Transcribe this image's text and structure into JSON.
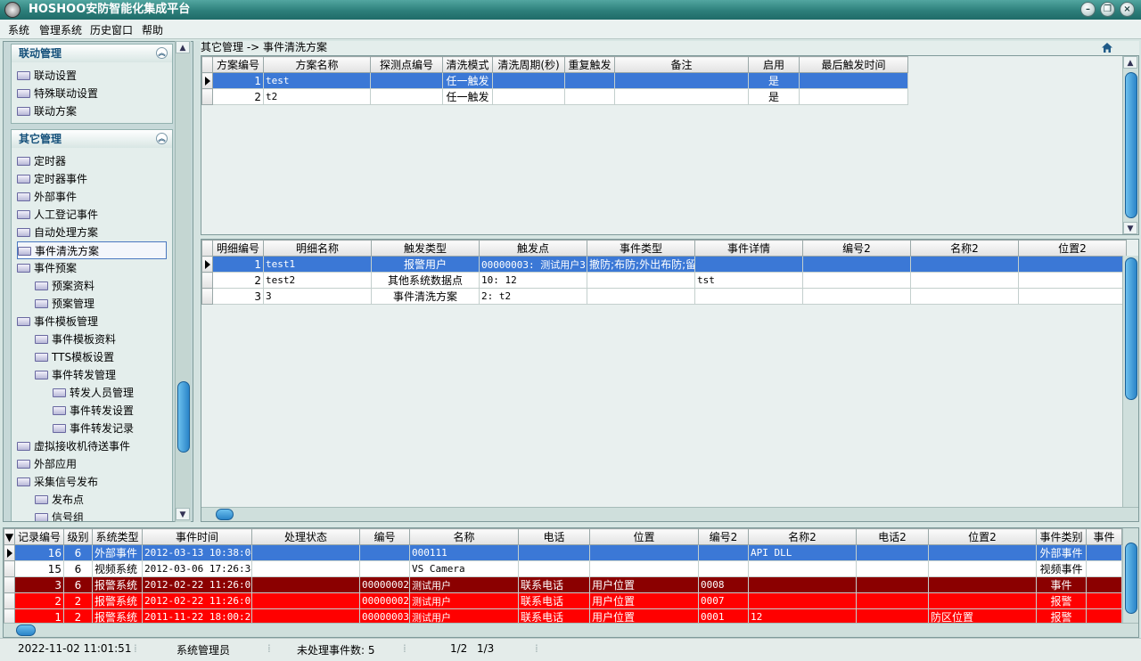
{
  "app": {
    "title": "HOSHOO安防智能化集成平台"
  },
  "menu": [
    "系统",
    "管理系统",
    "历史窗口",
    "帮助"
  ],
  "sidebar": {
    "group1": {
      "title": "联动管理",
      "items": [
        "联动设置",
        "特殊联动设置",
        "联动方案"
      ]
    },
    "group2": {
      "title": "其它管理",
      "items": [
        {
          "label": "定时器",
          "level": 0
        },
        {
          "label": "定时器事件",
          "level": 0
        },
        {
          "label": "外部事件",
          "level": 0
        },
        {
          "label": "人工登记事件",
          "level": 0
        },
        {
          "label": "自动处理方案",
          "level": 0
        },
        {
          "label": "事件清洗方案",
          "level": 0,
          "selected": true
        },
        {
          "label": "事件预案",
          "level": 0
        },
        {
          "label": "预案资料",
          "level": 1
        },
        {
          "label": "预案管理",
          "level": 1
        },
        {
          "label": "事件模板管理",
          "level": 0
        },
        {
          "label": "事件模板资料",
          "level": 1
        },
        {
          "label": "TTS模板设置",
          "level": 1
        },
        {
          "label": "事件转发管理",
          "level": 1
        },
        {
          "label": "转发人员管理",
          "level": 2
        },
        {
          "label": "事件转发设置",
          "level": 2
        },
        {
          "label": "事件转发记录",
          "level": 2
        },
        {
          "label": "虚拟接收机待送事件",
          "level": 0
        },
        {
          "label": "外部应用",
          "level": 0
        },
        {
          "label": "采集信号发布",
          "level": 0
        },
        {
          "label": "发布点",
          "level": 1
        },
        {
          "label": "信号组",
          "level": 1
        }
      ]
    }
  },
  "breadcrumb": "其它管理 -> 事件清洗方案",
  "plan_table": {
    "columns": [
      "方案编号",
      "方案名称",
      "探测点编号",
      "清洗模式",
      "清洗周期(秒)",
      "重复触发",
      "备注",
      "启用",
      "最后触发时间"
    ],
    "rows": [
      [
        "1",
        "test",
        "",
        "任一触发",
        "",
        "",
        "",
        "是",
        ""
      ],
      [
        "2",
        "t2",
        "",
        "任一触发",
        "",
        "",
        "",
        "是",
        ""
      ]
    ]
  },
  "detail_table": {
    "columns": [
      "明细编号",
      "明细名称",
      "触发类型",
      "触发点",
      "事件类型",
      "事件详情",
      "编号2",
      "名称2",
      "位置2"
    ],
    "rows": [
      [
        "1",
        "test1",
        "报警用户",
        "00000003: 测试用户3",
        "撤防;布防;外出布防;留",
        "",
        "",
        "",
        ""
      ],
      [
        "2",
        "test2",
        "其他系统数据点",
        "10: 12",
        "",
        "tst",
        "",
        "",
        ""
      ],
      [
        "3",
        "3",
        "事件清洗方案",
        "2: t2",
        "",
        "",
        "",
        "",
        ""
      ]
    ]
  },
  "event_table": {
    "columns": [
      "记录编号",
      "级别",
      "系统类型",
      "事件时间",
      "处理状态",
      "编号",
      "名称",
      "电话",
      "位置",
      "编号2",
      "名称2",
      "电话2",
      "位置2",
      "事件类别",
      "事件"
    ],
    "rows": [
      [
        "16",
        "6",
        "外部事件",
        "2012-03-13 10:38:04",
        "",
        "",
        "000111",
        "",
        "",
        "",
        "API DLL",
        "",
        "",
        "外部事件",
        ""
      ],
      [
        "15",
        "6",
        "视频系统",
        "2012-03-06 17:26:34",
        "",
        "",
        "VS Camera",
        "",
        "",
        "",
        "",
        "",
        "",
        "视频事件",
        ""
      ],
      [
        "3",
        "6",
        "报警系统",
        "2012-02-22 11:26:02",
        "",
        "00000002",
        "测试用户",
        "联系电话",
        "用户位置",
        "0008",
        "",
        "",
        "",
        "事件",
        ""
      ],
      [
        "2",
        "2",
        "报警系统",
        "2012-02-22 11:26:02",
        "",
        "00000002",
        "测试用户",
        "联系电话",
        "用户位置",
        "0007",
        "",
        "",
        "",
        "报警",
        ""
      ],
      [
        "1",
        "2",
        "报警系统",
        "2011-11-22 18:00:27",
        "",
        "00000003",
        "测试用户",
        "联系电话",
        "用户位置",
        "0001",
        "12",
        "",
        "防区位置",
        "报警",
        ""
      ]
    ]
  },
  "status": {
    "datetime": "2022-11-02 11:01:51",
    "user": "系统管理员",
    "pending": "未处理事件数: 5",
    "page1": "1/2",
    "page2": "1/3"
  },
  "colors": {
    "selected_row": "#3b78d6",
    "dark_red_row": "#8b0000",
    "red_row": "#ff0000",
    "title_bar": "#2d7f7b"
  }
}
